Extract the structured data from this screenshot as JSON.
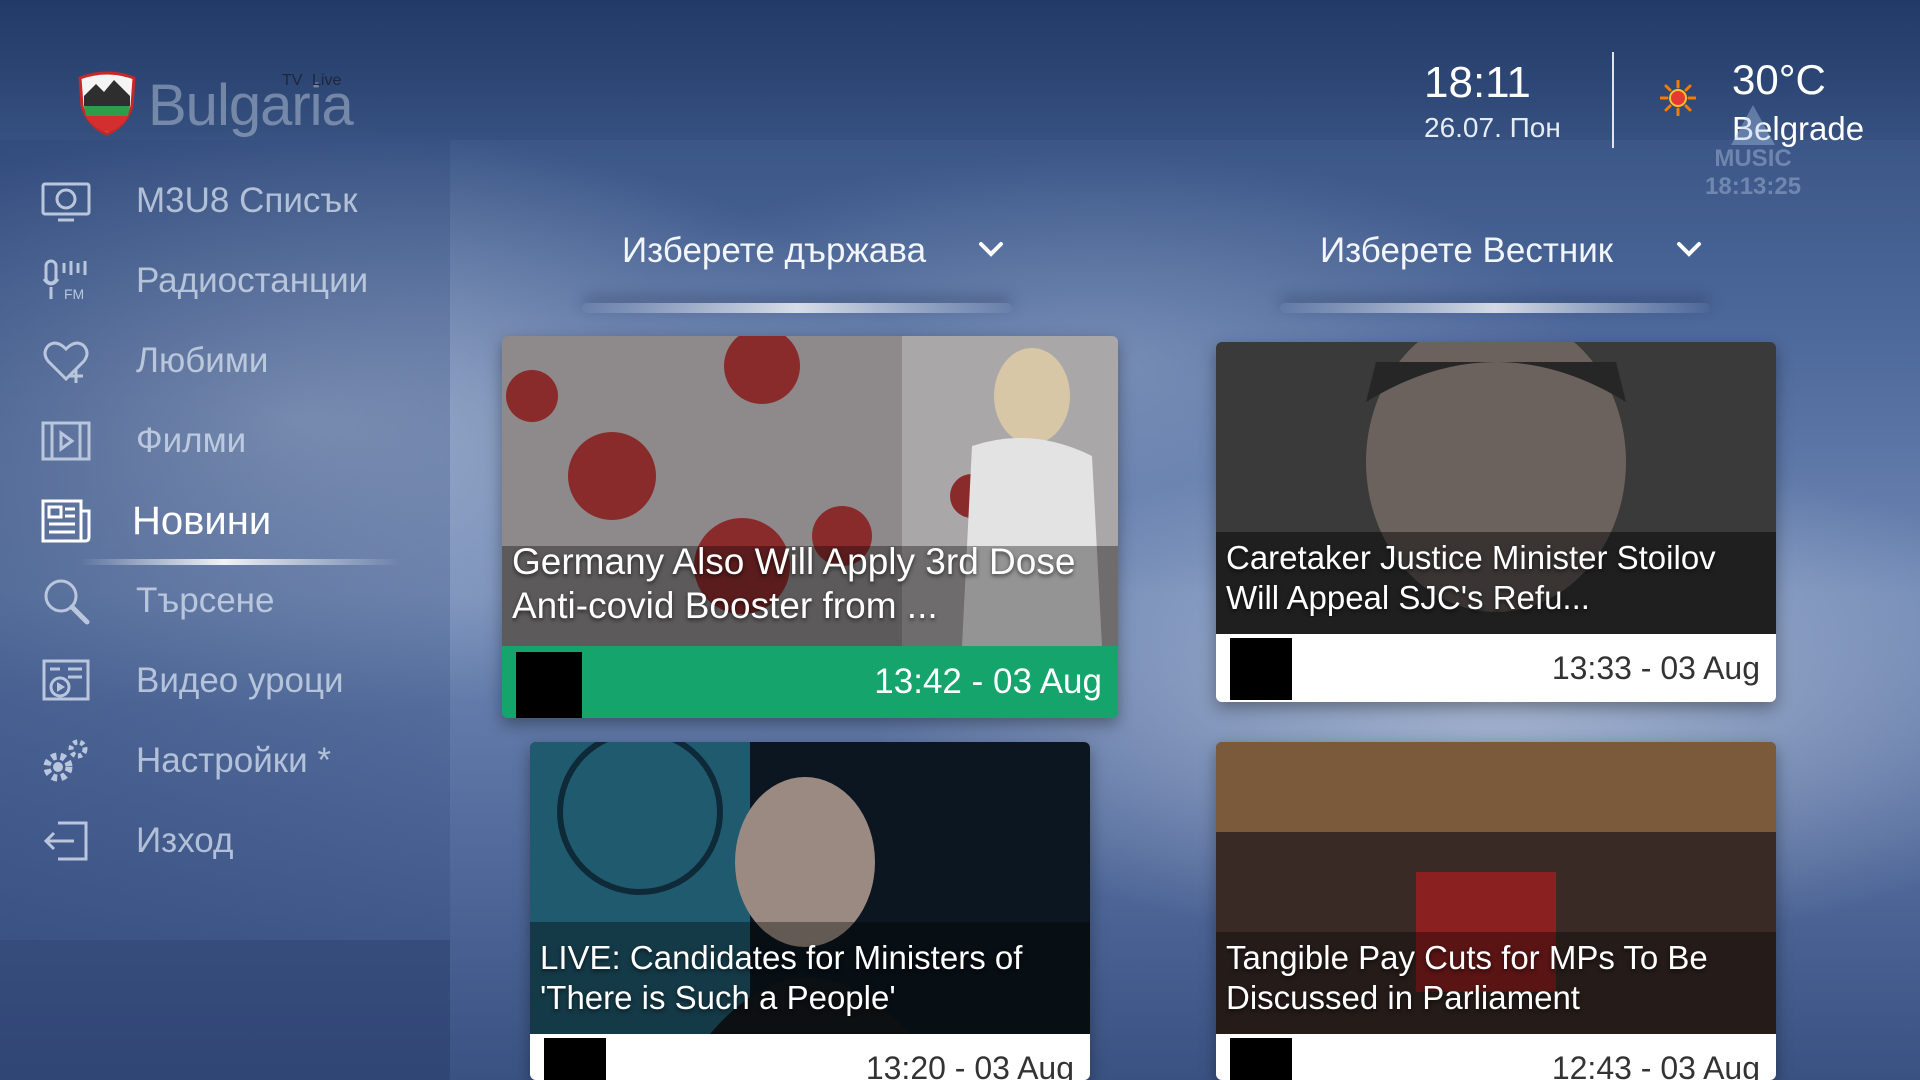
{
  "header": {
    "logo": {
      "word": "Bulgaria",
      "tv": "TV",
      "live": "Live"
    },
    "time": "18:11",
    "date": "26.07. Пон",
    "weather": {
      "temperature": "30°C",
      "city": "Belgrade",
      "icon": "sun-icon"
    },
    "watermark": {
      "line1": "MUSIC",
      "line2": "18:13:25"
    }
  },
  "sidebar": {
    "items": [
      {
        "label": "M3U8 Списък",
        "icon": "playlist-icon"
      },
      {
        "label": "Радиостанции",
        "icon": "radio-icon"
      },
      {
        "label": "Любими",
        "icon": "heart-icon"
      },
      {
        "label": "Филми",
        "icon": "film-icon"
      },
      {
        "label": "Новини",
        "icon": "news-icon",
        "active": true
      },
      {
        "label": "Търсене",
        "icon": "search-icon"
      },
      {
        "label": "Видео уроци",
        "icon": "video-lessons-icon"
      },
      {
        "label": "Настройки *",
        "icon": "settings-icon"
      },
      {
        "label": "Изход",
        "icon": "exit-icon"
      }
    ]
  },
  "filters": {
    "country": {
      "label": "Изберете държава",
      "icon": "chevron-down-icon"
    },
    "newspaper": {
      "label": "Изберете Вестник",
      "icon": "chevron-down-icon"
    }
  },
  "news": [
    {
      "title": "Germany Also Will Apply 3rd Dose Anti-covid Booster from ...",
      "timestamp": "13:42 - 03 Aug",
      "selected": true
    },
    {
      "title": "Caretaker Justice Minister Stoilov Will Appeal  SJC's Refu...",
      "timestamp": "13:33 - 03 Aug",
      "selected": false
    },
    {
      "title": "LIVE: Candidates for Ministers of 'There is Such a People'",
      "timestamp": "13:20 - 03 Aug",
      "selected": false
    },
    {
      "title": "Tangible Pay Cuts for MPs To Be Discussed in Parliament",
      "timestamp": "12:43 - 03 Aug",
      "selected": false
    }
  ],
  "colors": {
    "accent": "#14a46c",
    "background": "#4c679a"
  }
}
